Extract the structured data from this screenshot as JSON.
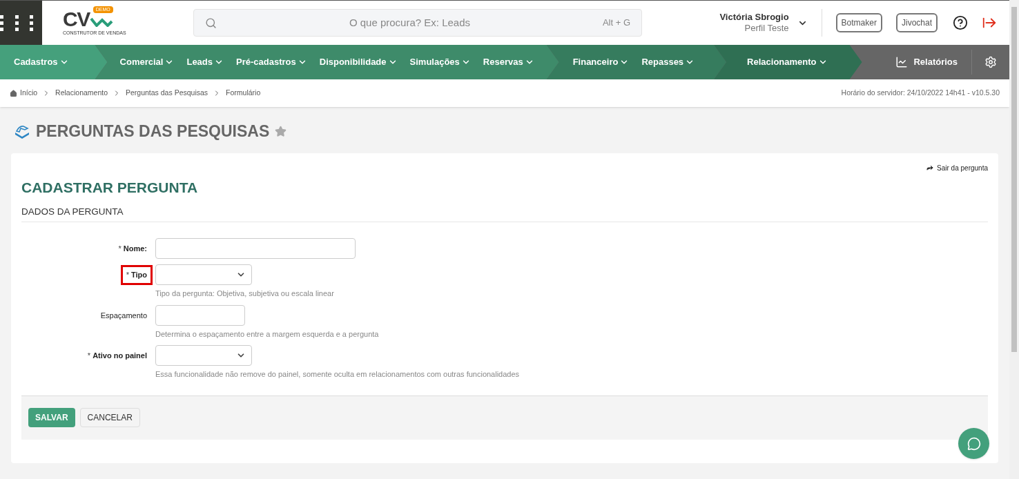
{
  "logo": {
    "mark": "CV",
    "badge": "DEMO",
    "tagline": "CONSTRUTOR DE VENDAS"
  },
  "search": {
    "placeholder": "O que procura? Ex: Leads",
    "shortcut": "Alt + G"
  },
  "user": {
    "name": "Victória Sbrogio",
    "profile": "Perfil Teste"
  },
  "header_buttons": [
    "Botmaker",
    "Jivochat"
  ],
  "nav": {
    "groups": [
      {
        "items": [
          "Cadastros"
        ]
      },
      {
        "items": [
          "Comercial",
          "Leads",
          "Pré-cadastros",
          "Disponibilidade",
          "Simulações",
          "Reservas"
        ]
      },
      {
        "items": [
          "Financeiro",
          "Repasses"
        ]
      },
      {
        "items": [
          "Relacionamento"
        ]
      }
    ],
    "reports": "Relatórios"
  },
  "breadcrumb": [
    "Início",
    "Relacionamento",
    "Perguntas das Pesquisas",
    "Formulário"
  ],
  "server_time": "Horário do servidor: 24/10/2022 14h41 - v10.5.30",
  "page_title": "PERGUNTAS DAS PESQUISAS",
  "favorite": false,
  "form": {
    "exit_link": "Sair da pergunta",
    "title": "CADASTRAR PERGUNTA",
    "section": "DADOS DA PERGUNTA",
    "fields": [
      {
        "kind": "wide_text",
        "label": "Nome:",
        "asterisk": "*",
        "highlighted": false
      },
      {
        "kind": "select",
        "label": "Tipo",
        "asterisk": "*",
        "highlighted": true,
        "help": "Tipo da pergunta: Objetiva, subjetiva ou escala linear"
      },
      {
        "kind": "short_text",
        "label": "Espaçamento",
        "highlighted": false,
        "help": "Determina o espaçamento entre a margem esquerda e a pergunta"
      },
      {
        "kind": "select",
        "label": "Ativo no painel",
        "asterisk": "*",
        "highlighted": false,
        "help": "Essa funcionalidade não remove do painel, somente oculta em relacionamentos com outras funcionalidades"
      }
    ],
    "actions": [
      {
        "kind": "primary",
        "label": "SALVAR"
      },
      {
        "kind": "secondary",
        "label": "CANCELAR"
      }
    ]
  }
}
